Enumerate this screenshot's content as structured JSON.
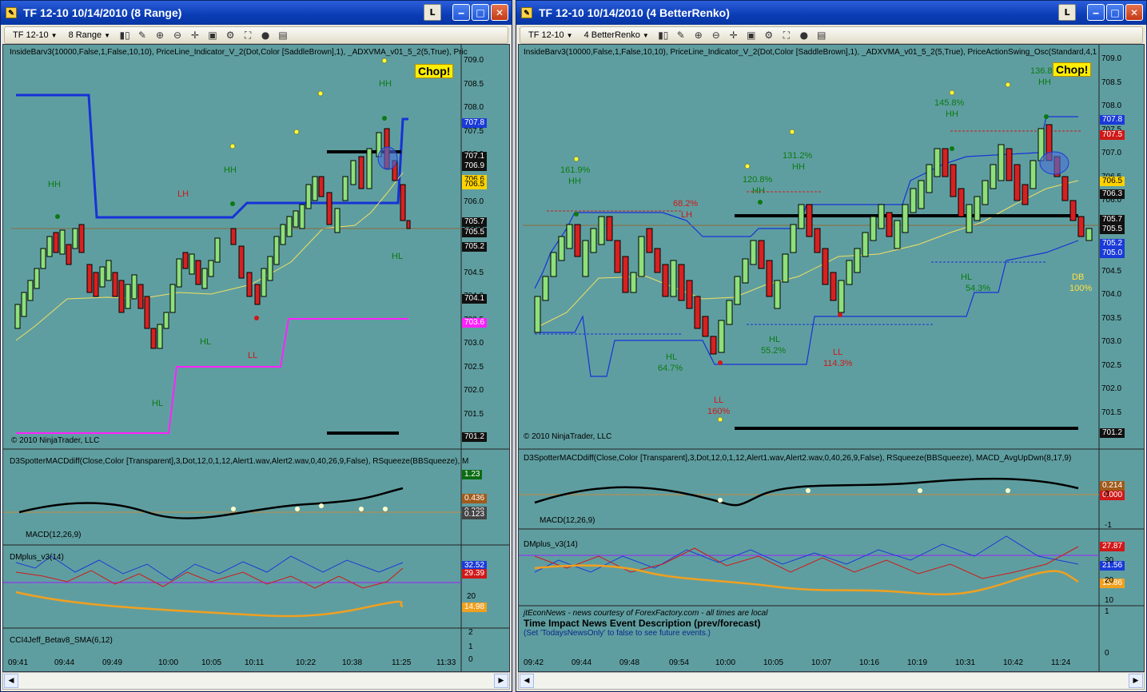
{
  "left": {
    "title": "TF 12-10  10/14/2010 (8 Range)",
    "btn_l": "L",
    "toolbar": {
      "instrument": "TF 12-10",
      "interval": "8 Range"
    },
    "indicators_label": "InsideBarv3(10000,False,1,False,10,10),  PriceLine_Indicator_V_2(Dot,Color [SaddleBrown],1),  _ADXVMA_v01_5_2(5,True),  Pric",
    "chop": "Chop!",
    "copyright": "© 2010 NinjaTrader, LLC",
    "price_axis": [
      "709.0",
      "708.5",
      "708.0",
      "707.5",
      "707.0",
      "706.5",
      "706.0",
      "705.5",
      "705.0",
      "704.5",
      "704.0",
      "703.5",
      "703.0",
      "702.5",
      "702.0",
      "701.5",
      "701.0"
    ],
    "price_tags": [
      {
        "v": "707.8",
        "bg": "#1a3bd8"
      },
      {
        "v": "707.1",
        "bg": "#111111"
      },
      {
        "v": "706.9",
        "bg": "#111111"
      },
      {
        "v": "706.6",
        "bg": "#ffd200"
      },
      {
        "v": "706.5",
        "bg": "#ffd200"
      },
      {
        "v": "705.7",
        "bg": "#111111"
      },
      {
        "v": "705.5",
        "bg": "#111111"
      },
      {
        "v": "705.2",
        "bg": "#111111"
      },
      {
        "v": "704.1",
        "bg": "#111111"
      },
      {
        "v": "703.6",
        "bg": "#ff20ff"
      },
      {
        "v": "701.2",
        "bg": "#111111"
      }
    ],
    "annotations": [
      {
        "t": "HH",
        "c": "green"
      },
      {
        "t": "HH",
        "c": "green"
      },
      {
        "t": "HH",
        "c": "green"
      },
      {
        "t": "LH",
        "c": "red"
      },
      {
        "t": "HL",
        "c": "green"
      },
      {
        "t": "HL",
        "c": "green"
      },
      {
        "t": "LL",
        "c": "red"
      },
      {
        "t": "HL",
        "c": "green"
      }
    ],
    "macd_label": "D3SpotterMACDdiff(Close,Color [Transparent],3,Dot,12,0,1,12,Alert1.wav,Alert2.wav,0,40,26,9,False), RSqueeze(BBSqueeze), M",
    "macd_sub": "MACD(12,26,9)",
    "macd_tags": [
      {
        "v": "1.23",
        "bg": "#0c6b12"
      },
      {
        "v": "0.436",
        "bg": "#a05a1a"
      },
      {
        "v": "0.238",
        "bg": "#444"
      },
      {
        "v": "0.123",
        "bg": "#444"
      }
    ],
    "dm_label": "DMplus_v3(14)",
    "dm_tags": [
      {
        "v": "32.52",
        "bg": "#1a3bd8"
      },
      {
        "v": "29.39",
        "bg": "#d01818"
      },
      {
        "v": "14.98",
        "bg": "#f0a020"
      }
    ],
    "dm_axis": [
      "20"
    ],
    "cci_label": "CCI4Jeff_Betav8_SMA(6,12)",
    "cci_axis": [
      "2",
      "1",
      "0"
    ],
    "times": [
      "09:41",
      "09:44",
      "09:49",
      "10:00",
      "10:05",
      "10:11",
      "10:22",
      "10:38",
      "11:25",
      "11:33"
    ]
  },
  "right": {
    "title": "TF 12-10  10/14/2010 (4 BetterRenko)",
    "btn_l": "L",
    "toolbar": {
      "instrument": "TF 12-10",
      "interval": "4 BetterRenko"
    },
    "indicators_label": "InsideBarv3(10000,False,1,False,10,10),  PriceLine_Indicator_V_2(Dot,Color [SaddleBrown],1),  _ADXVMA_v01_5_2(5,True),  PriceActionSwing_Osc(Standard,4,1",
    "chop": "Chop!",
    "copyright": "© 2010 NinjaTrader, LLC",
    "price_axis": [
      "709.0",
      "708.5",
      "708.0",
      "707.5",
      "707.0",
      "706.5",
      "706.0",
      "705.5",
      "705.0",
      "704.5",
      "704.0",
      "703.5",
      "703.0",
      "702.5",
      "702.0",
      "701.5",
      "701.0"
    ],
    "price_tags": [
      {
        "v": "707.8",
        "bg": "#1a3bd8"
      },
      {
        "v": "707.5",
        "bg": "#d01818"
      },
      {
        "v": "706.5",
        "bg": "#ffd200"
      },
      {
        "v": "706.3",
        "bg": "#111111"
      },
      {
        "v": "705.7",
        "bg": "#111111"
      },
      {
        "v": "705.5",
        "bg": "#111111"
      },
      {
        "v": "705.2",
        "bg": "#1a3bd8"
      },
      {
        "v": "705.0",
        "bg": "#1a3bd8"
      },
      {
        "v": "701.2",
        "bg": "#111111"
      }
    ],
    "annotations": [
      {
        "t": "161.9%",
        "c": "green"
      },
      {
        "t": "HH",
        "c": "green"
      },
      {
        "t": "120.8%",
        "c": "green"
      },
      {
        "t": "HH",
        "c": "green"
      },
      {
        "t": "131.2%",
        "c": "green"
      },
      {
        "t": "HH",
        "c": "green"
      },
      {
        "t": "145.8%",
        "c": "green"
      },
      {
        "t": "HH",
        "c": "green"
      },
      {
        "t": "136.8",
        "c": "green"
      },
      {
        "t": "HH",
        "c": "green"
      },
      {
        "t": "68.2%",
        "c": "red"
      },
      {
        "t": "LH",
        "c": "red"
      },
      {
        "t": "HL",
        "c": "green"
      },
      {
        "t": "54.3%",
        "c": "green"
      },
      {
        "t": "HL",
        "c": "green"
      },
      {
        "t": "55.2%",
        "c": "green"
      },
      {
        "t": "HL",
        "c": "green"
      },
      {
        "t": "64.7%",
        "c": "green"
      },
      {
        "t": "LL",
        "c": "red"
      },
      {
        "t": "114.3%",
        "c": "red"
      },
      {
        "t": "LL",
        "c": "red"
      },
      {
        "t": "160%",
        "c": "red"
      },
      {
        "t": "DB",
        "c": "yellow"
      },
      {
        "t": "100%",
        "c": "yellow"
      }
    ],
    "macd_label": "D3SpotterMACDdiff(Close,Color [Transparent],3,Dot,12,0,1,12,Alert1.wav,Alert2.wav,0,40,26,9,False), RSqueeze(BBSqueeze), MACD_AvgUpDwn(8,17,9)",
    "macd_sub": "MACD(12,26,9)",
    "macd_tags": [
      {
        "v": "0.214",
        "bg": "#a05a1a"
      },
      {
        "v": "0.000",
        "bg": "#d01818"
      }
    ],
    "macd_axis": [
      "0",
      "-1"
    ],
    "dm_label": "DMplus_v3(14)",
    "dm_tags": [
      {
        "v": "27.87",
        "bg": "#d01818"
      },
      {
        "v": "21.56",
        "bg": "#1a3bd8"
      },
      {
        "v": "15.86",
        "bg": "#f0a020"
      }
    ],
    "dm_axis": [
      "30",
      "20",
      "10"
    ],
    "cci_label": "CCI4Jeff_Betav8_SMA(6,12)",
    "cci_axis": [
      "1",
      "0"
    ],
    "news": {
      "credit": "jtEconNews - news courtesy of ForexFactory.com - all times are local",
      "header": "Time    Impact    News Event Description (prev/forecast)",
      "sub": "(Set 'TodaysNewsOnly' to false to see future events.)"
    },
    "times": [
      "09:42",
      "09:44",
      "09:48",
      "09:54",
      "10:00",
      "10:05",
      "10:07",
      "10:16",
      "10:19",
      "10:31",
      "10:42",
      "11:24"
    ]
  }
}
